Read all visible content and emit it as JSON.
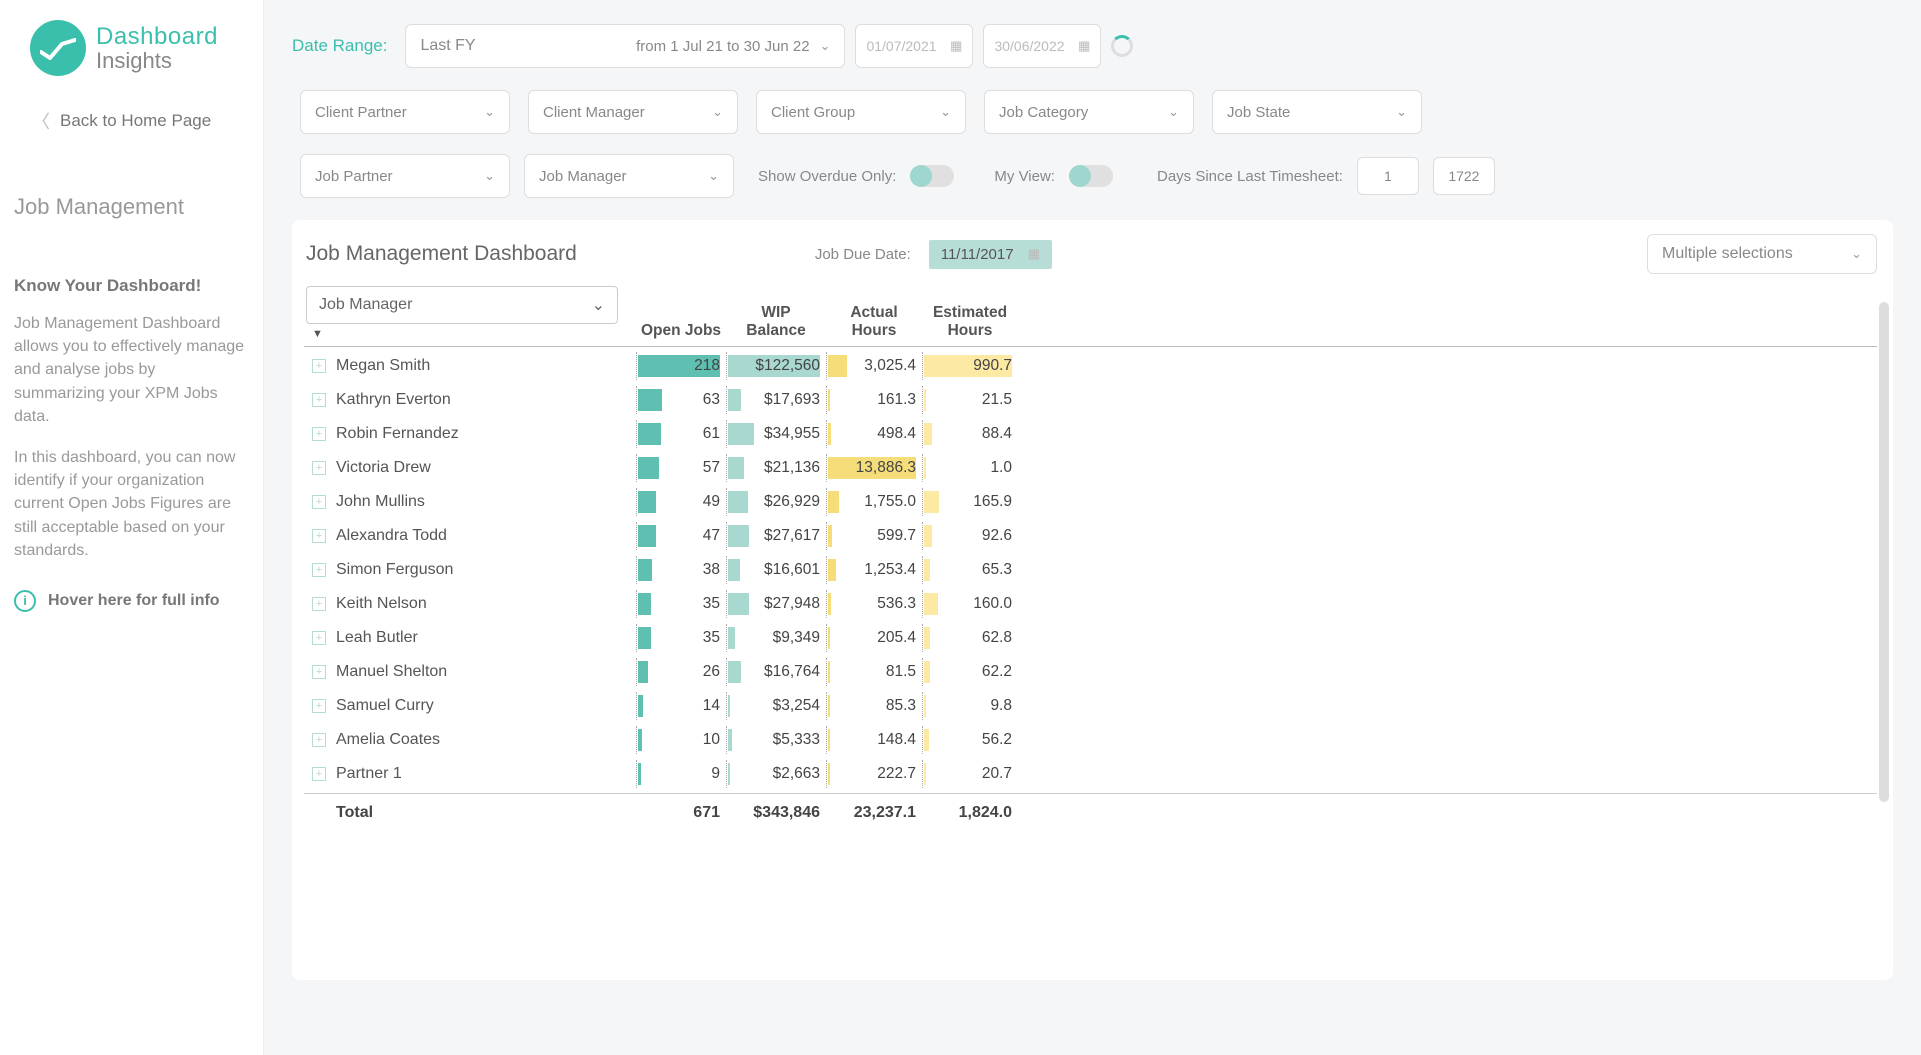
{
  "brand": {
    "line1": "Dashboard",
    "line2": "Insights"
  },
  "back_link": "Back to Home Page",
  "side": {
    "title": "Job Management",
    "know_title": "Know Your Dashboard!",
    "p1": "Job Management Dashboard allows you to effectively manage and analyse jobs by summarizing your XPM Jobs data.",
    "p2": "In this dashboard, you can now identify if your organization current Open Jobs Figures are still acceptable based on your standards.",
    "hover": "Hover here for full info"
  },
  "filters": {
    "date_range_label": "Date Range:",
    "fy_label": "Last FY",
    "fy_span": "from 1 Jul 21 to 30 Jun 22",
    "from": "01/07/2021",
    "to": "30/06/2022",
    "client_partner": "Client Partner",
    "client_manager": "Client Manager",
    "client_group": "Client Group",
    "job_category": "Job Category",
    "job_state": "Job State",
    "job_partner": "Job Partner",
    "job_manager": "Job Manager",
    "overdue_label": "Show Overdue Only:",
    "myview_label": "My View:",
    "days_label": "Days Since Last Timesheet:",
    "days_min": "1",
    "days_max": "1722"
  },
  "panel": {
    "title": "Job Management Dashboard",
    "due_label": "Job Due Date:",
    "due_date": "11/11/2017",
    "multi": "Multiple selections",
    "mgr_header": "Job Manager",
    "cols": {
      "open": "Open Jobs",
      "wip": "WIP Balance",
      "act": "Actual Hours",
      "est": "Estimated Hours"
    },
    "total_label": "Total",
    "totals": {
      "open": "671",
      "wip": "$343,846",
      "act": "23,237.1",
      "est": "1,824.0"
    }
  },
  "chart_data": {
    "type": "table",
    "columns": [
      "Job Manager",
      "Open Jobs",
      "WIP Balance",
      "Actual Hours",
      "Estimated Hours"
    ],
    "rows": [
      {
        "name": "Megan Smith",
        "open": 218,
        "open_txt": "218",
        "wip": 122560,
        "wip_txt": "$122,560",
        "act": 3025.4,
        "act_txt": "3,025.4",
        "est": 990.7,
        "est_txt": "990.7"
      },
      {
        "name": "Kathryn Everton",
        "open": 63,
        "open_txt": "63",
        "wip": 17693,
        "wip_txt": "$17,693",
        "act": 161.3,
        "act_txt": "161.3",
        "est": 21.5,
        "est_txt": "21.5"
      },
      {
        "name": "Robin Fernandez",
        "open": 61,
        "open_txt": "61",
        "wip": 34955,
        "wip_txt": "$34,955",
        "act": 498.4,
        "act_txt": "498.4",
        "est": 88.4,
        "est_txt": "88.4"
      },
      {
        "name": "Victoria Drew",
        "open": 57,
        "open_txt": "57",
        "wip": 21136,
        "wip_txt": "$21,136",
        "act": 13886.3,
        "act_txt": "13,886.3",
        "est": 1.0,
        "est_txt": "1.0"
      },
      {
        "name": "John Mullins",
        "open": 49,
        "open_txt": "49",
        "wip": 26929,
        "wip_txt": "$26,929",
        "act": 1755.0,
        "act_txt": "1,755.0",
        "est": 165.9,
        "est_txt": "165.9"
      },
      {
        "name": "Alexandra Todd",
        "open": 47,
        "open_txt": "47",
        "wip": 27617,
        "wip_txt": "$27,617",
        "act": 599.7,
        "act_txt": "599.7",
        "est": 92.6,
        "est_txt": "92.6"
      },
      {
        "name": "Simon Ferguson",
        "open": 38,
        "open_txt": "38",
        "wip": 16601,
        "wip_txt": "$16,601",
        "act": 1253.4,
        "act_txt": "1,253.4",
        "est": 65.3,
        "est_txt": "65.3"
      },
      {
        "name": "Keith Nelson",
        "open": 35,
        "open_txt": "35",
        "wip": 27948,
        "wip_txt": "$27,948",
        "act": 536.3,
        "act_txt": "536.3",
        "est": 160.0,
        "est_txt": "160.0"
      },
      {
        "name": "Leah Butler",
        "open": 35,
        "open_txt": "35",
        "wip": 9349,
        "wip_txt": "$9,349",
        "act": 205.4,
        "act_txt": "205.4",
        "est": 62.8,
        "est_txt": "62.8"
      },
      {
        "name": "Manuel Shelton",
        "open": 26,
        "open_txt": "26",
        "wip": 16764,
        "wip_txt": "$16,764",
        "act": 81.5,
        "act_txt": "81.5",
        "est": 62.2,
        "est_txt": "62.2"
      },
      {
        "name": "Samuel Curry",
        "open": 14,
        "open_txt": "14",
        "wip": 3254,
        "wip_txt": "$3,254",
        "act": 85.3,
        "act_txt": "85.3",
        "est": 9.8,
        "est_txt": "9.8"
      },
      {
        "name": "Amelia Coates",
        "open": 10,
        "open_txt": "10",
        "wip": 5333,
        "wip_txt": "$5,333",
        "act": 148.4,
        "act_txt": "148.4",
        "est": 56.2,
        "est_txt": "56.2"
      },
      {
        "name": "Partner 1",
        "open": 9,
        "open_txt": "9",
        "wip": 2663,
        "wip_txt": "$2,663",
        "act": 222.7,
        "act_txt": "222.7",
        "est": 20.7,
        "est_txt": "20.7"
      }
    ],
    "max": {
      "open": 218,
      "wip": 122560,
      "act": 13886.3,
      "est": 990.7
    }
  }
}
